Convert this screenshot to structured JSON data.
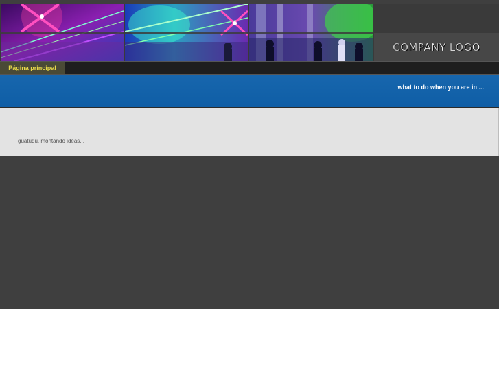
{
  "header": {
    "logo_text": "COMPANY LOGO",
    "banner_image": "nightclub-lasers-photo"
  },
  "nav": {
    "items": [
      {
        "label": "Página principal",
        "active": true
      }
    ]
  },
  "tagline": "what to do when you are in ...",
  "content": {
    "text": "guatudu. montando ideas..."
  },
  "colors": {
    "backdrop": "#3f3f3f",
    "blue_band": "#1766ad",
    "content_bg": "#e3e3e3",
    "nav_active_text": "#e6d84a",
    "nav_active_bg": "#4a4a36"
  }
}
